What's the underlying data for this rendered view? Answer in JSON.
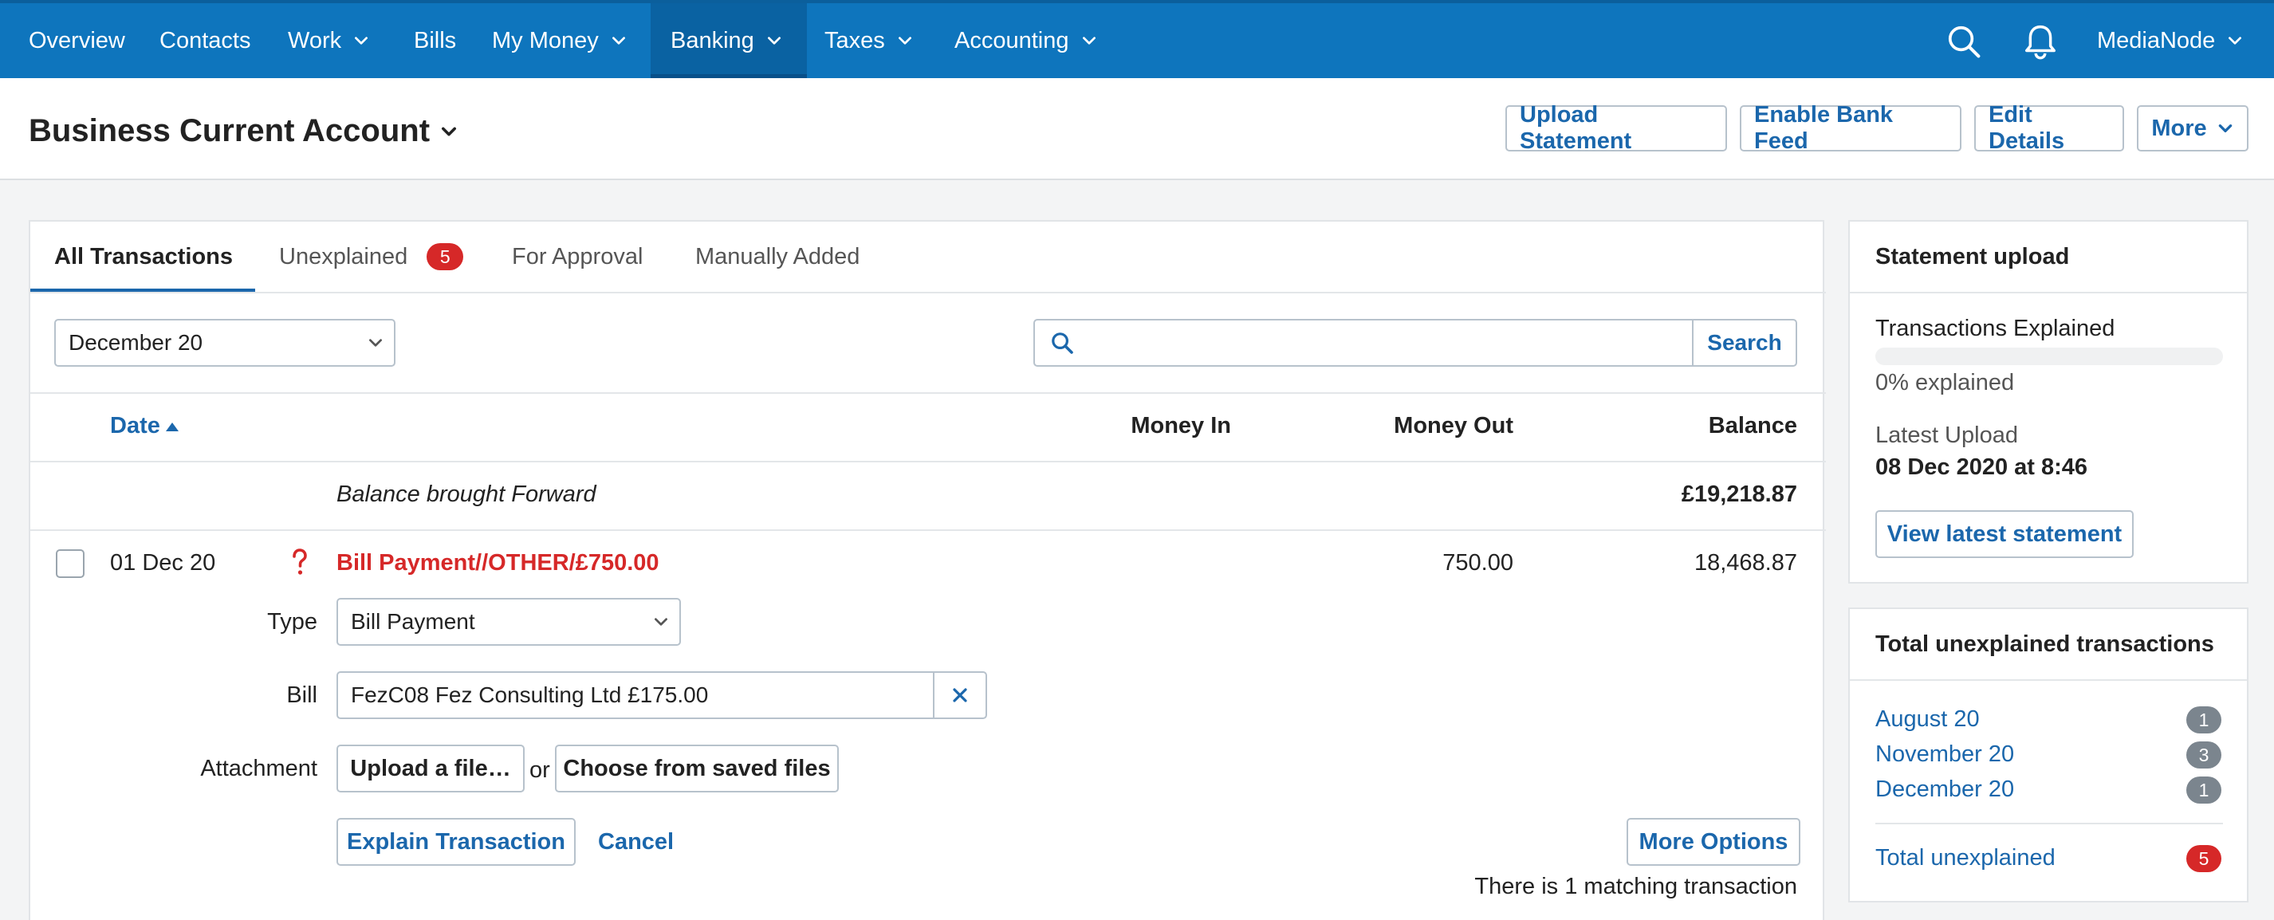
{
  "nav": {
    "items": [
      {
        "label": "Overview",
        "has_menu": false
      },
      {
        "label": "Contacts",
        "has_menu": false
      },
      {
        "label": "Work",
        "has_menu": true
      },
      {
        "label": "Bills",
        "has_menu": false
      },
      {
        "label": "My Money",
        "has_menu": true
      },
      {
        "label": "Banking",
        "has_menu": true,
        "active": true
      },
      {
        "label": "Taxes",
        "has_menu": true
      },
      {
        "label": "Accounting",
        "has_menu": true
      }
    ],
    "search_icon": "search-icon",
    "notification_icon": "bell-icon",
    "account_name": "MediaNode"
  },
  "header": {
    "title": "Business Current Account",
    "buttons": {
      "upload_statement": "Upload Statement",
      "enable_bank_feed": "Enable Bank Feed",
      "edit_details": "Edit Details",
      "more": "More"
    }
  },
  "tabs": [
    {
      "label": "All Transactions",
      "active": true
    },
    {
      "label": "Unexplained",
      "badge": "5"
    },
    {
      "label": "For Approval"
    },
    {
      "label": "Manually Added"
    }
  ],
  "filters": {
    "period": "December 20",
    "search_placeholder": "",
    "search_button": "Search"
  },
  "table": {
    "columns": {
      "date": "Date",
      "money_in": "Money In",
      "money_out": "Money Out",
      "balance": "Balance"
    },
    "brought_forward": {
      "label": "Balance brought Forward",
      "balance": "£19,218.87"
    },
    "transaction": {
      "date": "01 Dec 20",
      "status_icon": "question-mark-icon",
      "description": "Bill Payment//OTHER/£750.00",
      "money_out": "750.00",
      "balance": "18,468.87"
    }
  },
  "explain_form": {
    "type_label": "Type",
    "type_value": "Bill Payment",
    "bill_label": "Bill",
    "bill_value": "FezC08 Fez Consulting Ltd £175.00",
    "attachment_label": "Attachment",
    "upload_file": "Upload a file…",
    "or_text": "or",
    "choose_saved": "Choose from saved files",
    "explain_button": "Explain Transaction",
    "cancel_button": "Cancel",
    "more_options": "More Options",
    "matching_text": "There is 1 matching transaction"
  },
  "statement_card": {
    "title": "Statement upload",
    "explained_label": "Transactions Explained",
    "explained_progress": 0,
    "explained_text": "0% explained",
    "latest_upload_label": "Latest Upload",
    "latest_upload_value": "08 Dec 2020 at 8:46",
    "view_button": "View latest statement"
  },
  "unexplained_card": {
    "title": "Total unexplained transactions",
    "months": [
      {
        "label": "August 20",
        "count": "1"
      },
      {
        "label": "November 20",
        "count": "3"
      },
      {
        "label": "December 20",
        "count": "1"
      }
    ],
    "total_label": "Total unexplained",
    "total_count": "5"
  },
  "colors": {
    "nav_bg": "#0e75bd",
    "link": "#1b67ac",
    "alert_red": "#d62828"
  }
}
